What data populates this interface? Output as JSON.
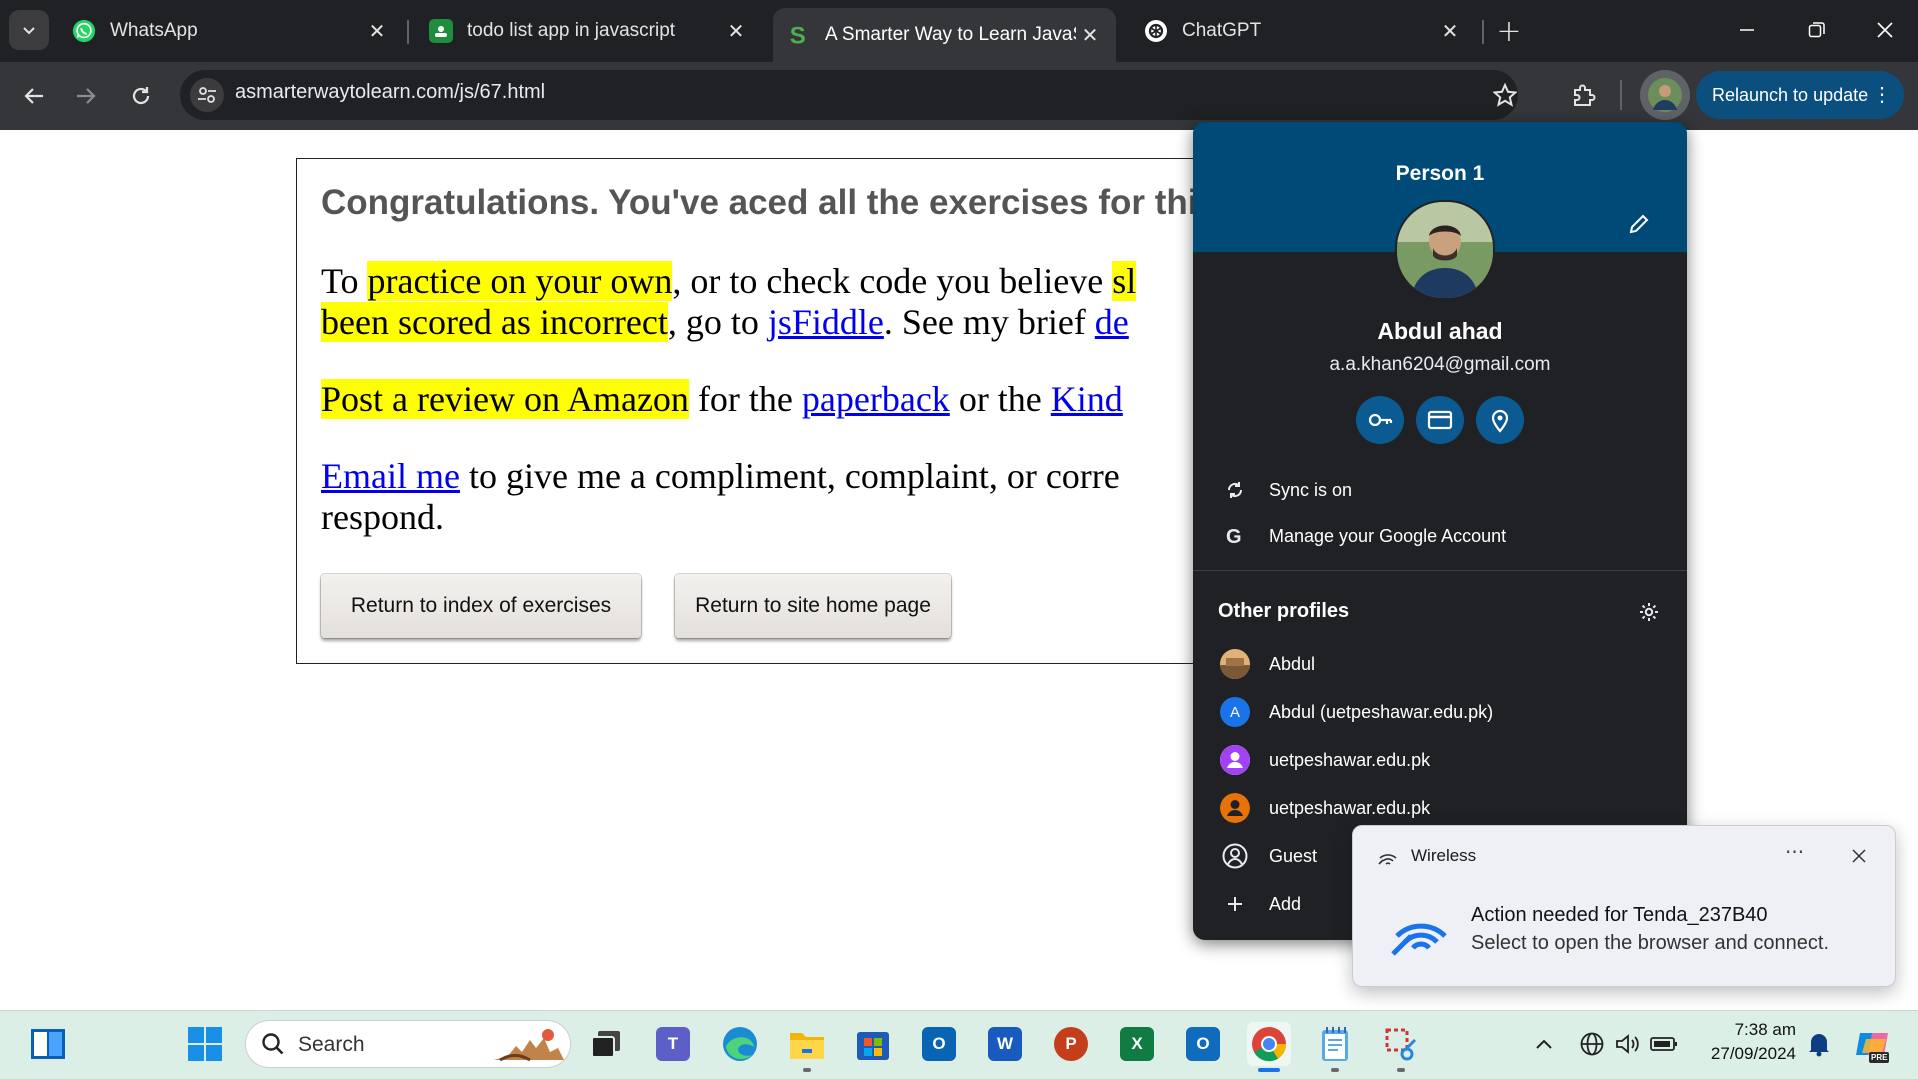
{
  "tabs": [
    {
      "title": "WhatsApp",
      "icon": "whatsapp-icon"
    },
    {
      "title": "todo list app in javascript",
      "icon": "classroom-icon"
    },
    {
      "title": "A Smarter Way to Learn JavaScr",
      "icon": "site-s-icon",
      "active": true
    },
    {
      "title": "ChatGPT",
      "icon": "chatgpt-icon"
    }
  ],
  "toolbar": {
    "url": "asmarterwaytolearn.com/js/67.html",
    "relaunch_label": "Relaunch to update"
  },
  "page": {
    "congrats": "Congratulations. You've aced all the exercises for thi",
    "p1": {
      "t1": "To ",
      "h1": "practice on your own",
      "t2": ", or to check code you believe ",
      "h2": "sl",
      "h3": "been scored as incorrect",
      "t3": ", go to ",
      "l1": "jsFiddle",
      "t4": ". See my brief ",
      "l2": "de"
    },
    "p2": {
      "h1": "Post a review on Amazon",
      "t1": " for the ",
      "l1": "paperback",
      "t2": " or the ",
      "l2": "Kind"
    },
    "p3": {
      "l1": "Email me",
      "t1": " to give me a compliment, complaint, or corre",
      "t2": "respond."
    },
    "btn_index": "Return to index of exercises",
    "btn_home": "Return to site home page"
  },
  "profile_menu": {
    "person_label": "Person 1",
    "name": "Abdul ahad",
    "email": "a.a.khan6204@gmail.com",
    "sync": "Sync is on",
    "manage": "Manage your Google Account",
    "other_profiles_label": "Other profiles",
    "profiles": [
      {
        "label": "Abdul",
        "avatar": "photo"
      },
      {
        "label": "Abdul (uetpeshawar.edu.pk)",
        "avatar": "A",
        "color": "#1a73e8"
      },
      {
        "label": "uetpeshawar.edu.pk",
        "avatar": "person",
        "color": "#a142f4"
      },
      {
        "label": "uetpeshawar.edu.pk",
        "avatar": "person",
        "color": "#e8710a"
      }
    ],
    "guest": "Guest",
    "add": "Add"
  },
  "notification": {
    "app": "Wireless",
    "title": "Action needed for Tenda_237B40",
    "body": "Select to open the browser and connect."
  },
  "taskbar": {
    "search_label": "Search",
    "time": "7:38 am",
    "date": "27/09/2024",
    "copilot_badge": "PRE"
  }
}
